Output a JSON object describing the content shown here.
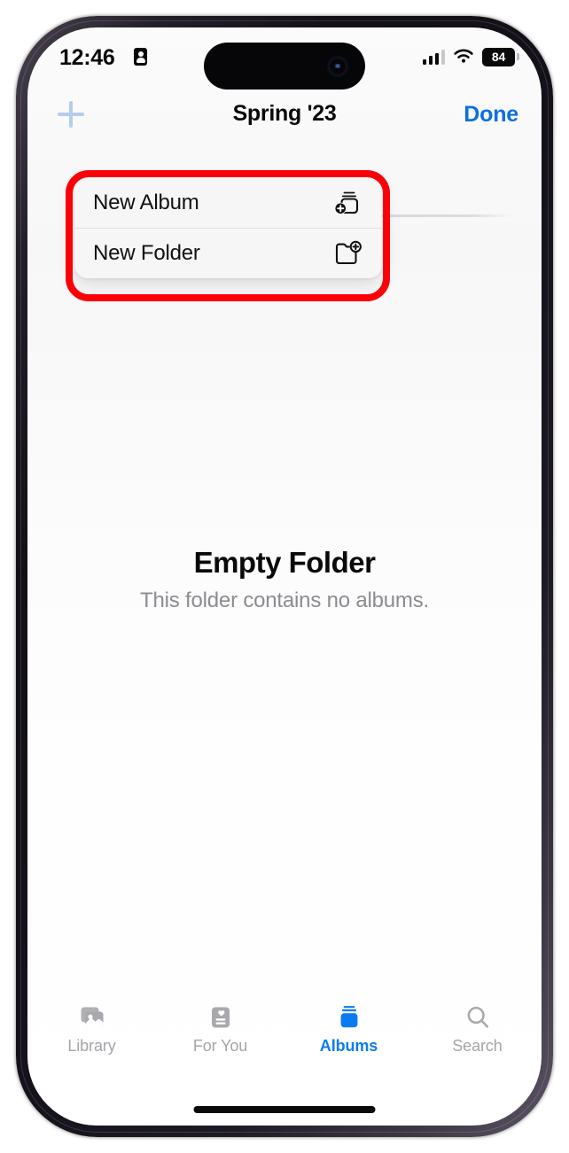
{
  "status_bar": {
    "time": "12:46",
    "recording_icon": "contact-card-icon",
    "cellular_icon": "cellular-bars-icon",
    "wifi_icon": "wifi-icon",
    "battery_level": "84"
  },
  "nav_bar": {
    "add_icon": "plus-icon",
    "title": "Spring '23",
    "done_label": "Done"
  },
  "context_menu": {
    "items": [
      {
        "label": "New Album",
        "icon": "new-album-icon"
      },
      {
        "label": "New Folder",
        "icon": "new-folder-icon"
      }
    ]
  },
  "annotation": {
    "color": "#fb0007",
    "target": "context-menu"
  },
  "empty_state": {
    "title": "Empty Folder",
    "subtitle": "This folder contains no albums."
  },
  "tab_bar": {
    "active_color": "#0b7cf0",
    "inactive_color": "#a5a5aa",
    "tabs": [
      {
        "label": "Library",
        "icon": "photo-stack-icon",
        "active": false
      },
      {
        "label": "For You",
        "icon": "for-you-card-icon",
        "active": false
      },
      {
        "label": "Albums",
        "icon": "albums-stack-icon",
        "active": true
      },
      {
        "label": "Search",
        "icon": "magnifier-icon",
        "active": false
      }
    ]
  }
}
